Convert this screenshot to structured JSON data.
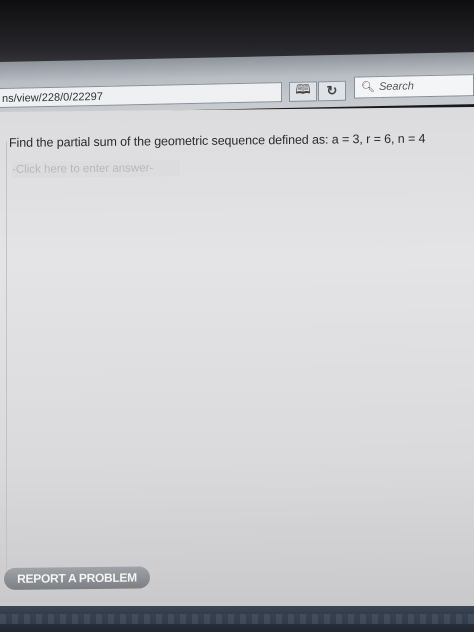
{
  "browser": {
    "url": "ns/view/228/0/22297",
    "search_placeholder": "Search",
    "reader_icon": "book-icon",
    "reload_icon": "reload-icon",
    "search_icon": "search-icon"
  },
  "question": {
    "text": "Find the partial sum of the geometric sequence defined as:  a = 3, r = 6, n = 4"
  },
  "answer": {
    "placeholder": "-Click here to enter answer-"
  },
  "report_button": {
    "label": "REPORT A PROBLEM"
  }
}
